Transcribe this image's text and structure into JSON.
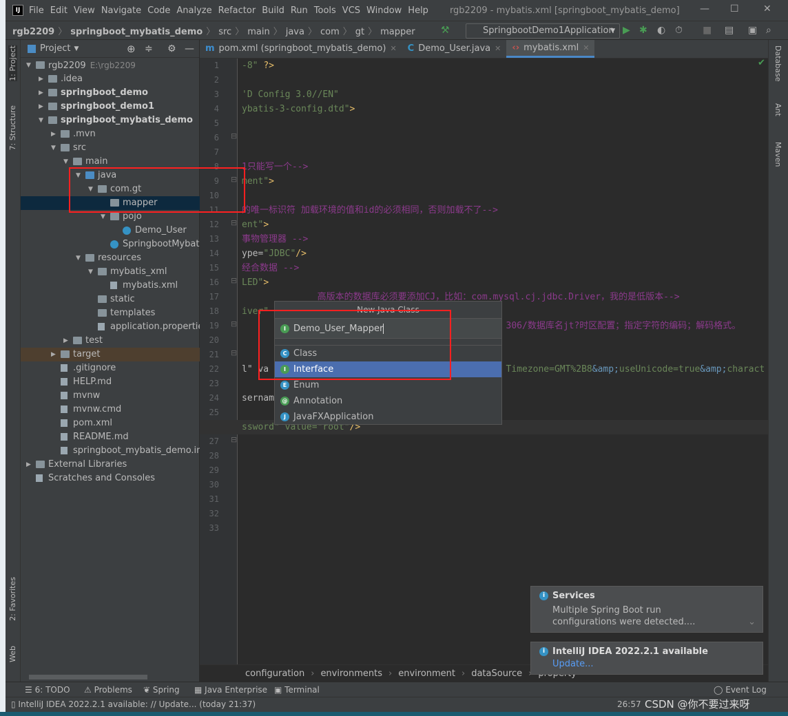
{
  "window": {
    "title": "rgb2209 - mybatis.xml [springboot_mybatis_demo]",
    "logo": "IJ"
  },
  "menu": [
    "File",
    "Edit",
    "View",
    "Navigate",
    "Code",
    "Analyze",
    "Refactor",
    "Build",
    "Run",
    "Tools",
    "VCS",
    "Window",
    "Help"
  ],
  "breadcrumb": [
    "rgb2209",
    "springboot_mybatis_demo",
    "src",
    "main",
    "java",
    "com",
    "gt",
    "mapper"
  ],
  "run_config": "SpringbootDemo1Application",
  "left_tools": [
    "1: Project",
    "7: Structure",
    "2: Favorites",
    "Web"
  ],
  "right_tools": [
    "Database",
    "Ant",
    "Maven"
  ],
  "project_panel": {
    "title": "Project",
    "tree": [
      {
        "label": "rgb2209",
        "path": "E:\\rgb2209",
        "level": 0,
        "expanded": true,
        "icon": "folder"
      },
      {
        "label": ".idea",
        "level": 1,
        "expanded": false,
        "icon": "folder"
      },
      {
        "label": "springboot_demo",
        "level": 1,
        "expanded": false,
        "icon": "module",
        "bold": true
      },
      {
        "label": "springboot_demo1",
        "level": 1,
        "expanded": false,
        "icon": "module",
        "bold": true
      },
      {
        "label": "springboot_mybatis_demo",
        "level": 1,
        "expanded": true,
        "icon": "module",
        "bold": true
      },
      {
        "label": ".mvn",
        "level": 2,
        "expanded": false,
        "icon": "folder"
      },
      {
        "label": "src",
        "level": 2,
        "expanded": true,
        "icon": "folder"
      },
      {
        "label": "main",
        "level": 3,
        "expanded": true,
        "icon": "folder"
      },
      {
        "label": "java",
        "level": 4,
        "expanded": true,
        "icon": "source-folder"
      },
      {
        "label": "com.gt",
        "level": 5,
        "expanded": true,
        "icon": "package"
      },
      {
        "label": "mapper",
        "level": 6,
        "icon": "package",
        "selected": true
      },
      {
        "label": "pojo",
        "level": 6,
        "expanded": true,
        "icon": "package"
      },
      {
        "label": "Demo_User",
        "level": 7,
        "icon": "class"
      },
      {
        "label": "SpringbootMybatis",
        "level": 6,
        "icon": "class"
      },
      {
        "label": "resources",
        "level": 4,
        "expanded": true,
        "icon": "folder"
      },
      {
        "label": "mybatis_xml",
        "level": 5,
        "expanded": true,
        "icon": "folder"
      },
      {
        "label": "mybatis.xml",
        "level": 6,
        "icon": "file"
      },
      {
        "label": "static",
        "level": 5,
        "icon": "folder"
      },
      {
        "label": "templates",
        "level": 5,
        "icon": "folder"
      },
      {
        "label": "application.properties",
        "level": 5,
        "icon": "file"
      },
      {
        "label": "test",
        "level": 3,
        "expanded": false,
        "icon": "folder"
      },
      {
        "label": "target",
        "level": 2,
        "expanded": false,
        "icon": "folder",
        "highlight": true
      },
      {
        "label": ".gitignore",
        "level": 2,
        "icon": "file"
      },
      {
        "label": "HELP.md",
        "level": 2,
        "icon": "file"
      },
      {
        "label": "mvnw",
        "level": 2,
        "icon": "file"
      },
      {
        "label": "mvnw.cmd",
        "level": 2,
        "icon": "file"
      },
      {
        "label": "pom.xml",
        "level": 2,
        "icon": "file"
      },
      {
        "label": "README.md",
        "level": 2,
        "icon": "file"
      },
      {
        "label": "springboot_mybatis_demo.iml",
        "level": 2,
        "icon": "file"
      },
      {
        "label": "External Libraries",
        "level": 0,
        "expanded": false,
        "icon": "library"
      },
      {
        "label": "Scratches and Consoles",
        "level": 0,
        "icon": "scratch"
      }
    ]
  },
  "tabs": [
    {
      "label": "pom.xml (springboot_mybatis_demo)",
      "icon": "maven-icon"
    },
    {
      "label": "Demo_User.java",
      "icon": "class-icon"
    },
    {
      "label": "mybatis.xml",
      "icon": "xml-icon",
      "active": true
    }
  ],
  "editor": {
    "current_line": 26,
    "lines": [
      [
        {
          "t": "-8\" ",
          "c": "str"
        },
        {
          "t": "?>",
          "c": "tag"
        }
      ],
      [],
      [
        {
          "t": "'D Config 3.0//EN\"",
          "c": "str"
        }
      ],
      [
        {
          "t": "ybatis-3-config.dtd\"",
          "c": "str"
        },
        {
          "t": ">",
          "c": "tag"
        }
      ],
      [],
      [],
      [],
      [
        {
          "t": "1只能写一个-->",
          "c": "com"
        }
      ],
      [
        {
          "t": "ment\"",
          "c": "str"
        },
        {
          "t": ">",
          "c": "tag"
        }
      ],
      [],
      [
        {
          "t": "的唯一标识符 加载环境的值和id的必须相同，否则加载不了-->",
          "c": "com"
        }
      ],
      [
        {
          "t": "ent\"",
          "c": "str"
        },
        {
          "t": ">",
          "c": "tag"
        }
      ],
      [
        {
          "t": "事物管理器 -->",
          "c": "com"
        }
      ],
      [
        {
          "t": "ype=",
          "c": "attr"
        },
        {
          "t": "\"JDBC\"",
          "c": "str"
        },
        {
          "t": "/>",
          "c": "tag"
        }
      ],
      [
        {
          "t": "经合数据 -->",
          "c": "com"
        }
      ],
      [
        {
          "t": "LED\"",
          "c": "str"
        },
        {
          "t": ">",
          "c": "tag"
        }
      ],
      [
        {
          "t": "              高版本的数据库必须要添加CJ，比如：com.mysql.cj.jdbc.Driver，我的是低版本-->",
          "c": "com"
        }
      ],
      [
        {
          "t": "iver\"",
          "c": "str"
        }
      ],
      [
        {
          "t": "                                                 306/数据库名jt?时区配置；指定字符的编码；解码格式。",
          "c": "com"
        }
      ],
      [],
      [],
      [
        {
          "t": "l\" va",
          "c": "attr"
        },
        {
          "t": "                                            Timezone=GMT%2B8",
          "c": "str"
        },
        {
          "t": "&amp;",
          "c": "ent"
        },
        {
          "t": "useUnicode=true",
          "c": "str"
        },
        {
          "t": "&amp;",
          "c": "ent"
        },
        {
          "t": "charact",
          "c": "str"
        }
      ],
      [],
      [
        {
          "t": "sername",
          "c": "attr"
        }
      ],
      [],
      [
        {
          "t": "ssword\" value=\"root\"",
          "c": "str"
        },
        {
          "t": "/>",
          "c": "tag"
        }
      ],
      [],
      [],
      [],
      [],
      [],
      [],
      []
    ]
  },
  "dialog": {
    "title": "New Java Class",
    "input_value": "Demo_User_Mapper",
    "kinds": [
      {
        "label": "Class",
        "letter": "C",
        "color": "#3592c4"
      },
      {
        "label": "Interface",
        "letter": "I",
        "color": "#499c54",
        "selected": true
      },
      {
        "label": "Enum",
        "letter": "E",
        "color": "#3592c4"
      },
      {
        "label": "Annotation",
        "letter": "@",
        "color": "#499c54"
      },
      {
        "label": "JavaFXApplication",
        "letter": "J",
        "color": "#3592c4"
      }
    ]
  },
  "editor_breadcrumb": [
    "configuration",
    "environments",
    "environment",
    "dataSource",
    "property"
  ],
  "notifications": [
    {
      "title": "Services",
      "body": "Multiple Spring Boot run configurations were detected...."
    },
    {
      "title": "IntelliJ IDEA 2022.2.1 available",
      "link": "Update..."
    }
  ],
  "tool_windows": [
    "6: TODO",
    "Problems",
    "Spring",
    "Java Enterprise",
    "Terminal",
    "Event Log"
  ],
  "status": {
    "message": "IntelliJ IDEA 2022.2.1 available: // Update... (today 21:37)",
    "position": "26:57",
    "watermark": "CSDN @你不要过来呀"
  },
  "colors": {
    "accent": "#4b6eaf",
    "highlight_box": "#ff2020",
    "link": "#589df6"
  }
}
